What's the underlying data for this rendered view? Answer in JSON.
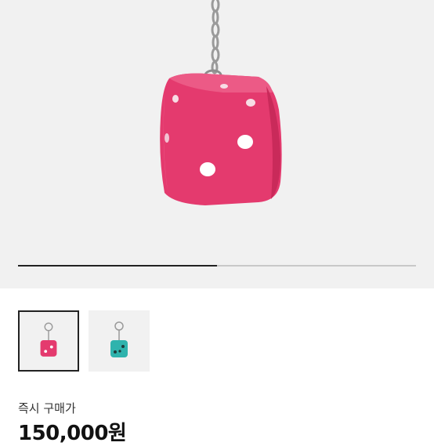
{
  "product": {
    "images": [
      {
        "name": "pink-dice-keychain",
        "color": "#e43a6e"
      },
      {
        "name": "teal-dice-keychain",
        "color": "#2fb3ad"
      }
    ],
    "selected_image_index": 0,
    "carousel_progress": 0.5
  },
  "price": {
    "label": "즉시 구매가",
    "value": "150,000원"
  }
}
